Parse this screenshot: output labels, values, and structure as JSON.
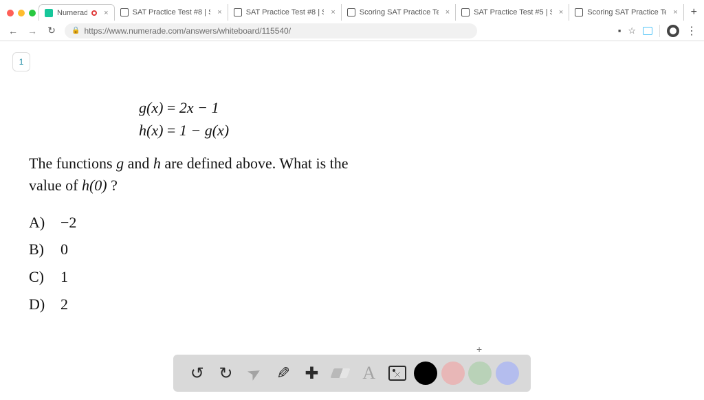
{
  "tabs": [
    {
      "title": "Numerade",
      "favicon": "numerade",
      "active": true
    },
    {
      "title": "SAT Practice Test #8 | SA",
      "favicon": "kh"
    },
    {
      "title": "SAT Practice Test #8 | SA",
      "favicon": "kh"
    },
    {
      "title": "Scoring SAT Practice Test",
      "favicon": "kh"
    },
    {
      "title": "SAT Practice Test #5 | SA",
      "favicon": "kh"
    },
    {
      "title": "Scoring SAT Practice Test",
      "favicon": "kh"
    }
  ],
  "plus_tab": "+",
  "nav": {
    "back": "←",
    "forward": "→",
    "reload": "↻"
  },
  "address": {
    "lock": "🔒",
    "url": "https://www.numerade.com/answers/whiteboard/115540/"
  },
  "right_icons": {
    "rec": "●",
    "star": "☆",
    "kebab": "⋮"
  },
  "page": {
    "tab1_label": "1",
    "eq1_lhs": "g(x)",
    "eq1_eq": " = ",
    "eq1_rhs": "2x − 1",
    "eq2_lhs": "h(x)",
    "eq2_eq": " = ",
    "eq2_rhs": "1 − g(x)",
    "prompt_a": "The functions ",
    "g": "g",
    "and": " and ",
    "h": "h",
    "prompt_b": " are defined above. What is the",
    "prompt_c": "value of ",
    "h0": "h(0)",
    "qmark": " ?",
    "choices": [
      {
        "letter": "A)",
        "val": "−2"
      },
      {
        "letter": "B)",
        "val": "0"
      },
      {
        "letter": "C)",
        "val": "1"
      },
      {
        "letter": "D)",
        "val": "2"
      }
    ],
    "mini_plus": "+"
  },
  "wb": {
    "undo": "↺",
    "redo": "↻",
    "pointer": "➤",
    "pencil": "✎",
    "plus": "✚",
    "text": "A"
  }
}
